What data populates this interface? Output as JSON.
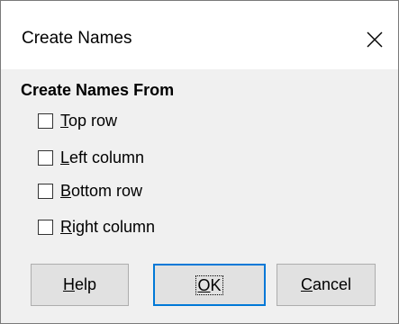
{
  "dialog": {
    "title": "Create Names",
    "close_glyph": "×"
  },
  "section": {
    "heading": "Create Names From"
  },
  "options": [
    {
      "mnemonic": "T",
      "rest": "op row",
      "checked": false
    },
    {
      "mnemonic": "L",
      "rest": "eft column",
      "checked": false
    },
    {
      "mnemonic": "B",
      "rest": "ottom row",
      "checked": false
    },
    {
      "mnemonic": "R",
      "rest": "ight column",
      "checked": false
    }
  ],
  "buttons": {
    "help": {
      "mnemonic": "H",
      "rest": "elp"
    },
    "ok": {
      "mnemonic": "O",
      "rest": "K"
    },
    "cancel": {
      "mnemonic": "C",
      "rest": "ancel"
    }
  },
  "colors": {
    "focus_border": "#0078d7",
    "dialog_background": "#f0f0f0",
    "titlebar_background": "#ffffff"
  }
}
